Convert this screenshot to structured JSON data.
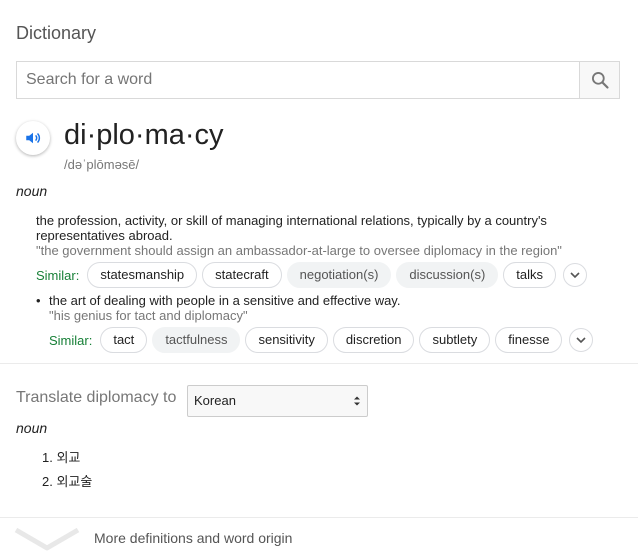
{
  "app": {
    "title": "Dictionary"
  },
  "search": {
    "placeholder": "Search for a word",
    "value": ""
  },
  "entry": {
    "headword": "di·plo·ma·cy",
    "phonetic": "/dəˈplōməsē/",
    "part_of_speech": "noun",
    "senses": [
      {
        "definition": "the profession, activity, or skill of managing international relations, typically by a country's representatives abroad.",
        "example": "\"the government should assign an ambassador-at-large to oversee diplomacy in the region\"",
        "similar_label": "Similar:",
        "similar": [
          "statesmanship",
          "statecraft",
          "negotiation(s)",
          "discussion(s)",
          "talks"
        ]
      },
      {
        "bullet": "•",
        "definition": "the art of dealing with people in a sensitive and effective way.",
        "example": "\"his genius for tact and diplomacy\"",
        "similar_label": "Similar:",
        "similar": [
          "tact",
          "tactfulness",
          "sensitivity",
          "discretion",
          "subtlety",
          "finesse"
        ]
      }
    ]
  },
  "translate": {
    "label": "Translate diplomacy to",
    "language": "Korean",
    "part_of_speech": "noun",
    "items": [
      "1. 외교",
      "2. 외교술"
    ]
  },
  "footer": {
    "more_label": "More definitions and word origin"
  },
  "icons": {
    "search": "search-icon",
    "speaker": "speaker-icon",
    "expand": "chevron-down-icon",
    "select": "up-down-arrows-icon",
    "more": "chevron-down-icon"
  },
  "colors": {
    "accent": "#1a73e8",
    "similar_label": "#188038",
    "chip_gray": "#f1f3f4"
  }
}
